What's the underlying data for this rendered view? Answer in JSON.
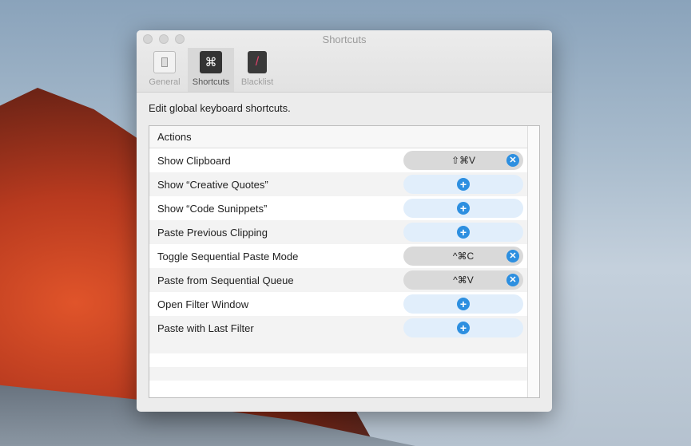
{
  "window": {
    "title": "Shortcuts"
  },
  "tabs": [
    {
      "label": "General"
    },
    {
      "label": "Shortcuts"
    },
    {
      "label": "Blacklist"
    }
  ],
  "hint": "Edit global keyboard shortcuts.",
  "table": {
    "header": "Actions",
    "rows": [
      {
        "action": "Show Clipboard",
        "shortcut": "⇧⌘V"
      },
      {
        "action": "Show “Creative Quotes”",
        "shortcut": ""
      },
      {
        "action": "Show “Code Sunippets”",
        "shortcut": ""
      },
      {
        "action": "Paste Previous Clipping",
        "shortcut": ""
      },
      {
        "action": "Toggle Sequential Paste Mode",
        "shortcut": "^⌘C"
      },
      {
        "action": "Paste from Sequential Queue",
        "shortcut": "^⌘V"
      },
      {
        "action": "Open Filter Window",
        "shortcut": ""
      },
      {
        "action": "Paste with Last Filter",
        "shortcut": ""
      }
    ]
  }
}
